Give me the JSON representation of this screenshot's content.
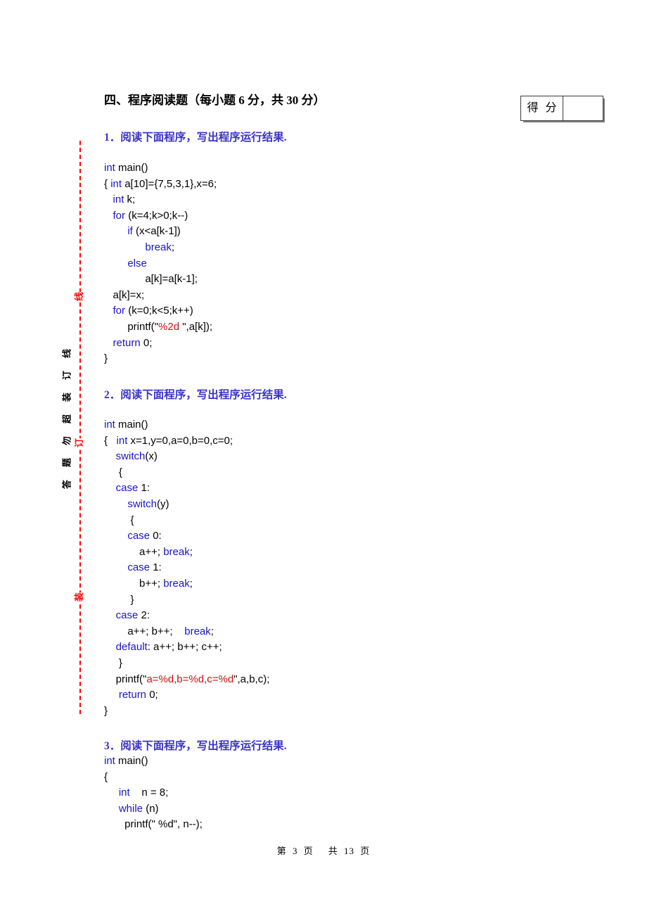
{
  "section": {
    "heading": "四、程序阅读题（每小题 6 分，共 30 分）"
  },
  "score_box": {
    "label": "得 分",
    "value": ""
  },
  "binding_margin": {
    "red_labels": [
      "线",
      "订",
      "装"
    ],
    "vertical_text_chars": [
      "线",
      "订",
      "装",
      "超",
      "勿",
      "题",
      "答"
    ]
  },
  "questions": [
    {
      "prompt": "1．阅读下面程序，写出程序运行结果.",
      "code": "int main()\n{ int a[10]={7,5,3,1},x=6;\n   int k;\n   for (k=4;k>0;k--)\n        if (x<a[k-1])\n              break;\n        else\n              a[k]=a[k-1];\n   a[k]=x;\n   for (k=0;k<5;k++)\n        printf(\"%2d \",a[k]);\n   return 0;\n}"
    },
    {
      "prompt": "2．阅读下面程序，写出程序运行结果.",
      "code": "int main()\n{   int x=1,y=0,a=0,b=0,c=0;\n    switch(x)\n     {\n    case 1:\n        switch(y)\n         {\n        case 0:\n            a++; break;\n        case 1:\n            b++; break;\n         }\n    case 2:\n        a++; b++;    break;\n    default: a++; b++; c++;\n     }\n    printf(\"a=%d,b=%d,c=%d\",a,b,c);\n     return 0;\n}"
    },
    {
      "prompt": "3．阅读下面程序，写出程序运行结果.",
      "code": "int main()\n{\n     int    n = 8;\n     while (n)\n       printf(\" %d\", n--);"
    }
  ],
  "footer": {
    "page_prefix": "第",
    "page_number": "3",
    "page_unit": "页",
    "total_prefix": "共",
    "total_number": "13",
    "total_unit": "页"
  },
  "colors": {
    "keyword": "#1a14d2",
    "string": "#cc1111",
    "prompt": "#3a33c8",
    "binding_red": "#ff0000"
  }
}
